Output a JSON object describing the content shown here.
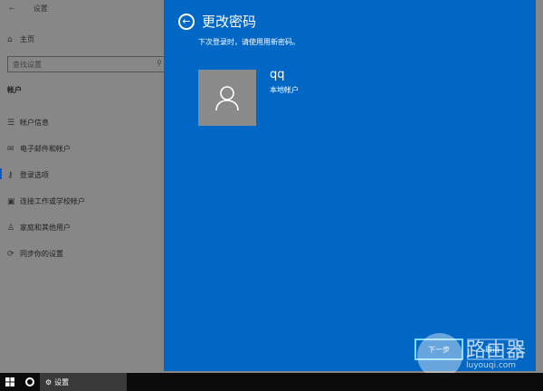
{
  "window": {
    "back": "←",
    "title": "设置"
  },
  "sidebar": {
    "home": "主页",
    "search_placeholder": "查找设置",
    "section": "帐户",
    "items": [
      {
        "icon": "account-info-icon",
        "label": "帐户信息"
      },
      {
        "icon": "mail-icon",
        "label": "电子邮件和帐户"
      },
      {
        "icon": "key-icon",
        "label": "登录选项"
      },
      {
        "icon": "briefcase-icon",
        "label": "连接工作或学校帐户"
      },
      {
        "icon": "person-icon",
        "label": "家庭和其他用户"
      },
      {
        "icon": "sync-icon",
        "label": "同步你的设置"
      }
    ]
  },
  "dialog": {
    "title": "更改密码",
    "subtitle": "下次登录时，请使用用新密码。",
    "username": "qq",
    "account_type": "本地帐户",
    "next": "下一步",
    "cancel": "取消"
  },
  "watermark": {
    "brand": "路由器",
    "url": "luyouqi.com"
  },
  "taskbar": {
    "app": "设置"
  }
}
